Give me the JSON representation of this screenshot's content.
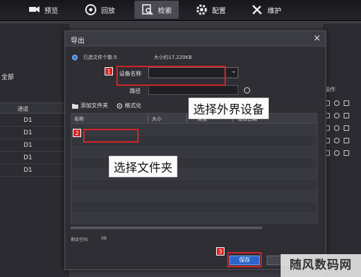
{
  "nav": {
    "items": [
      {
        "label": "预览",
        "icon": "camera-icon"
      },
      {
        "label": "回放",
        "icon": "playback-icon"
      },
      {
        "label": "检索",
        "icon": "search-icon"
      },
      {
        "label": "配置",
        "icon": "gear-icon"
      },
      {
        "label": "维护",
        "icon": "tools-icon"
      }
    ],
    "active": "检索"
  },
  "background": {
    "all_label": "全部",
    "channel_header": "通道",
    "rows": [
      "D1",
      "D1",
      "D1",
      "D1",
      "D1"
    ],
    "ops_header": "操作"
  },
  "dialog": {
    "title": "导出",
    "close": "×",
    "selected_files": "已选文件个数:5",
    "size": "大小约17,220KB",
    "device_label": "设备名称",
    "device_value": "",
    "device_arrow": "⌄",
    "path_label": "路径",
    "path_value": "",
    "add_folder": "添加文件夹",
    "format": "格式化",
    "columns": [
      "名称",
      "大小",
      "类型",
      "修改日期"
    ],
    "free_space_label": "剩余空间:",
    "free_space_value": "0B",
    "save": "保存"
  },
  "annotations": {
    "badges": [
      "1",
      "2",
      "3"
    ],
    "callout_device": "选择外界设备",
    "callout_folder": "选择文件夹"
  },
  "watermark": "随风数码网",
  "colors": {
    "accent": "#2d66c9",
    "annotation_red": "#d42424",
    "dialog_bg": "#2e2e34"
  }
}
